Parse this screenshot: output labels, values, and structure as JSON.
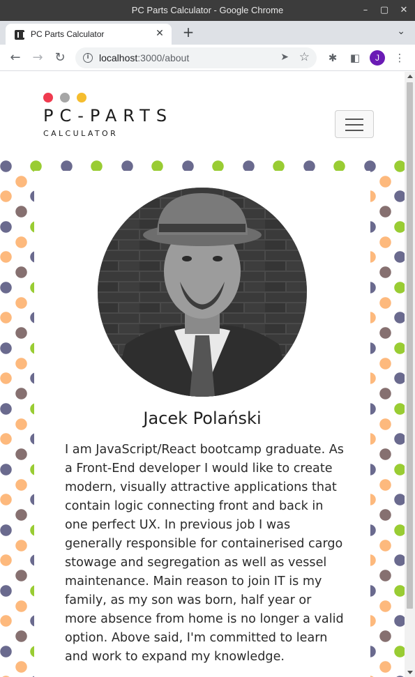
{
  "window": {
    "title": "PC Parts Calculator - Google Chrome",
    "minimize": "–",
    "maximize": "▢",
    "close": "✕"
  },
  "tabs": [
    {
      "title": "PC Parts Calculator",
      "close": "✕"
    }
  ],
  "tabstrip": {
    "new_tab": "+",
    "tab_search": "⌄"
  },
  "toolbar": {
    "back": "←",
    "forward": "→",
    "reload": "↻",
    "url_host": "localhost",
    "url_path": ":3000/about",
    "site_info": "i",
    "send": "➤",
    "bookmark": "☆",
    "extensions": "✱",
    "side_panel": "◧",
    "profile_initial": "J",
    "menu": "⋮"
  },
  "site": {
    "logo_wordmark": "PC-PARTS",
    "logo_sub": "CALCULATOR",
    "logo_dot_colors": [
      "#ef3b4f",
      "#a6a6a6",
      "#f5bd2e"
    ]
  },
  "profile": {
    "name": "Jacek Polański",
    "bio": "I am JavaScript/React bootcamp graduate. As a Front-End developer I would like to create modern, visually attractive applications that contain logic connecting front and back in one perfect UX. In previous job I was generally responsible for containerised cargo stowage and segregation as well as vessel maintenance. Main reason to join IT is my family, as my son was born, half year or more absence from home is no longer a valid option. Above said, I'm committed to learn and work to expand my knowledge."
  },
  "colors": {
    "titlebar": "#3c3c3c",
    "tabstrip": "#dee1e6",
    "avatar": "#6a1bb5",
    "pattern": [
      "#6a6a8e",
      "#99cc33",
      "#fdb97d",
      "#867070"
    ]
  }
}
